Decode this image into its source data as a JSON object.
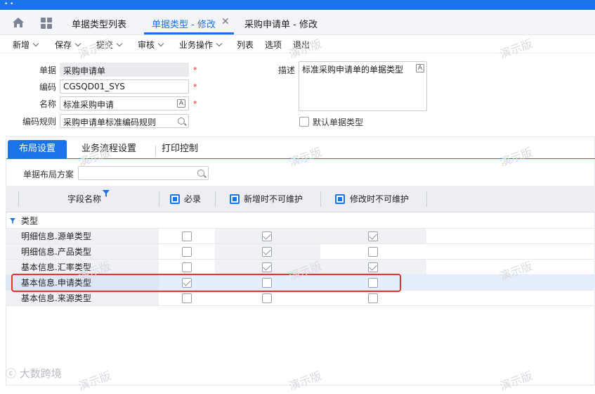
{
  "colors": {
    "primary": "#1a73e8",
    "required": "#e02020",
    "highlight": "#e0332e"
  },
  "topbar": {
    "dots": "• •"
  },
  "tabs": [
    {
      "label": "单据类型列表",
      "active": false
    },
    {
      "label": "单据类型 - 修改",
      "active": true
    },
    {
      "label": "采购申请单 - 修改",
      "active": false
    }
  ],
  "toolbar": {
    "items": [
      {
        "label": "新增",
        "has_menu": true
      },
      {
        "label": "保存",
        "has_menu": true
      },
      {
        "label": "提交",
        "has_menu": true
      },
      {
        "label": "审核",
        "has_menu": true
      },
      {
        "label": "业务操作",
        "has_menu": true
      },
      {
        "label": "列表",
        "has_menu": false
      },
      {
        "label": "选项",
        "has_menu": false
      },
      {
        "label": "退出",
        "has_menu": false
      }
    ]
  },
  "form": {
    "document": {
      "label": "单据",
      "value": "采购申请单",
      "required": "*"
    },
    "code": {
      "label": "编码",
      "value": "CGSQD01_SYS",
      "required": "*"
    },
    "name": {
      "label": "名称",
      "value": "标准采购申请",
      "required": "*"
    },
    "code_rule": {
      "label": "编码规则",
      "value": "采购申请单标准编码规则"
    },
    "description": {
      "label": "描述",
      "value": "标准采购申请单的单据类型"
    },
    "default_type": {
      "label": "默认单据类型",
      "checked": false
    }
  },
  "panel_tabs": [
    {
      "label": "布局设置",
      "active": true
    },
    {
      "label": "业务流程设置",
      "active": false
    },
    {
      "label": "打印控制",
      "active": false
    }
  ],
  "layout_scheme": {
    "label": "单据布局方案",
    "value": ""
  },
  "table": {
    "headers": {
      "field": "字段名称",
      "required": "必录",
      "no_edit_add": "新增时不可维护",
      "no_edit_modify": "修改时不可维护"
    },
    "group": "类型",
    "rows": [
      {
        "name": "明细信息.源单类型",
        "required": false,
        "no_edit_add": true,
        "no_edit_modify": true
      },
      {
        "name": "明细信息.产品类型",
        "required": false,
        "no_edit_add": true,
        "no_edit_modify": false
      },
      {
        "name": "基本信息.汇率类型",
        "required": false,
        "no_edit_add": true,
        "no_edit_modify": true
      },
      {
        "name": "基本信息.申请类型",
        "required": true,
        "no_edit_add": false,
        "no_edit_modify": false,
        "selected": true
      },
      {
        "name": "基本信息.来源类型",
        "required": false,
        "no_edit_add": false,
        "no_edit_modify": false
      }
    ]
  },
  "watermark": "演示版",
  "logo_text": "大数跨境",
  "icons": [
    "home-icon",
    "app-grid-icon",
    "close-icon",
    "chevron-down-icon",
    "search-icon",
    "translate-icon",
    "filter-icon"
  ]
}
